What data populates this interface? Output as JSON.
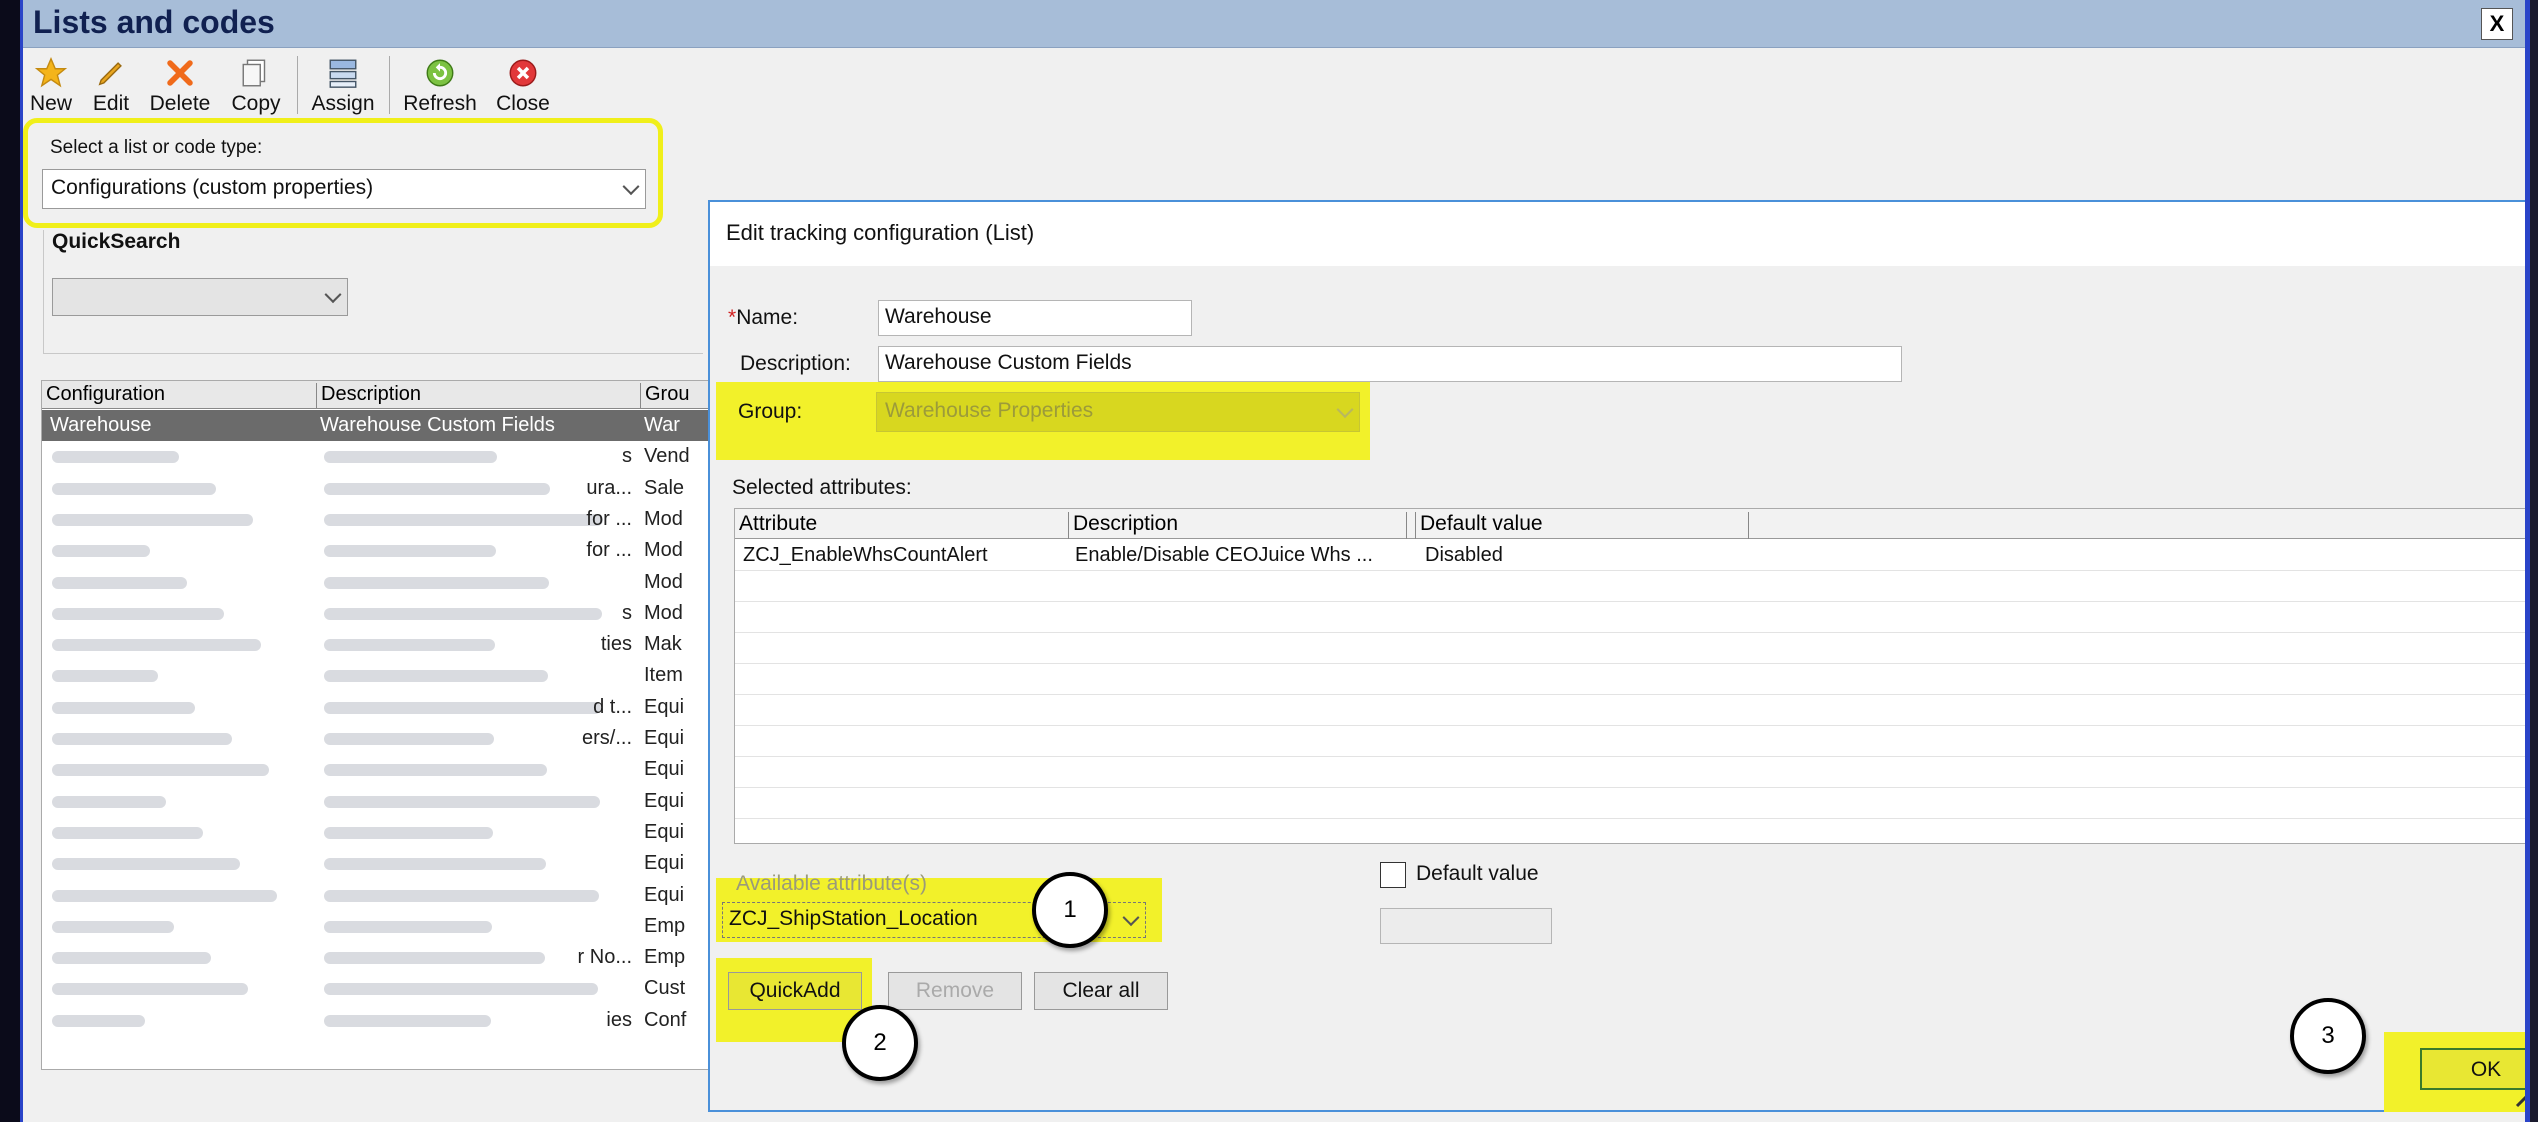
{
  "window": {
    "title": "Lists and codes",
    "close_label": "X"
  },
  "toolbar": [
    {
      "label": "New",
      "icon": "star-icon"
    },
    {
      "label": "Edit",
      "icon": "pencil-icon"
    },
    {
      "label": "Delete",
      "icon": "delete-x-icon"
    },
    {
      "label": "Copy",
      "icon": "copy-icon"
    },
    {
      "label": "Assign",
      "icon": "assign-icon"
    },
    {
      "label": "Refresh",
      "icon": "refresh-icon"
    },
    {
      "label": "Close",
      "icon": "close-circle-icon"
    }
  ],
  "selector": {
    "label": "Select a list or code type:",
    "value": "Configurations (custom properties)"
  },
  "quicksearch": {
    "label": "QuickSearch",
    "value": ""
  },
  "list": {
    "columns": [
      "Configuration",
      "Description",
      "Grou"
    ],
    "rows": [
      {
        "config": "Warehouse",
        "desc": "Warehouse Custom Fields",
        "group": "War",
        "selected": true
      },
      {
        "config": "",
        "desc": "s",
        "group": "Vend"
      },
      {
        "config": "",
        "desc": "ura...",
        "group": "Sale"
      },
      {
        "config": "",
        "desc": "for ...",
        "group": "Mod"
      },
      {
        "config": "",
        "desc": "for ...",
        "group": "Mod"
      },
      {
        "config": "",
        "desc": "",
        "group": "Mod"
      },
      {
        "config": "",
        "desc": "s",
        "group": "Mod"
      },
      {
        "config": "",
        "desc": "ties",
        "group": "Mak"
      },
      {
        "config": "",
        "desc": "",
        "group": "Item"
      },
      {
        "config": "",
        "desc": "d t...",
        "group": "Equi"
      },
      {
        "config": "",
        "desc": "ers/...",
        "group": "Equi"
      },
      {
        "config": "",
        "desc": "",
        "group": "Equi"
      },
      {
        "config": "",
        "desc": "",
        "group": "Equi"
      },
      {
        "config": "",
        "desc": "",
        "group": "Equi"
      },
      {
        "config": "",
        "desc": "",
        "group": "Equi"
      },
      {
        "config": "",
        "desc": "",
        "group": "Equi"
      },
      {
        "config": "",
        "desc": "",
        "group": "Emp"
      },
      {
        "config": "",
        "desc": "r No...",
        "group": "Emp"
      },
      {
        "config": "",
        "desc": "",
        "group": "Cust"
      },
      {
        "config": "",
        "desc": "ies",
        "group": "Conf"
      }
    ]
  },
  "dialog": {
    "title": "Edit tracking configuration (List)",
    "name_label": "Name:",
    "required_mark": "*",
    "name_value": "Warehouse",
    "description_label": "Description:",
    "description_value": "Warehouse Custom Fields",
    "group_label": "Group:",
    "group_value": "Warehouse Properties",
    "selected_attributes_label": "Selected attributes:",
    "attr_columns": [
      "Attribute",
      "Description",
      "Default value"
    ],
    "attr_rows": [
      {
        "attribute": "ZCJ_EnableWhsCountAlert",
        "description": "Enable/Disable CEOJuice Whs ...",
        "default": "Disabled"
      }
    ],
    "available_label": "Available attribute(s)",
    "available_value": "ZCJ_ShipStation_Location",
    "default_value_label": "Default value",
    "quickadd_label": "QuickAdd",
    "remove_label": "Remove",
    "clearall_label": "Clear all",
    "ok_label": "OK"
  },
  "callouts": [
    "1",
    "2",
    "3"
  ],
  "colors": {
    "highlight": "#f2f12a",
    "title_bar": "#a7bdd8",
    "window_border": "#2a44c8"
  }
}
